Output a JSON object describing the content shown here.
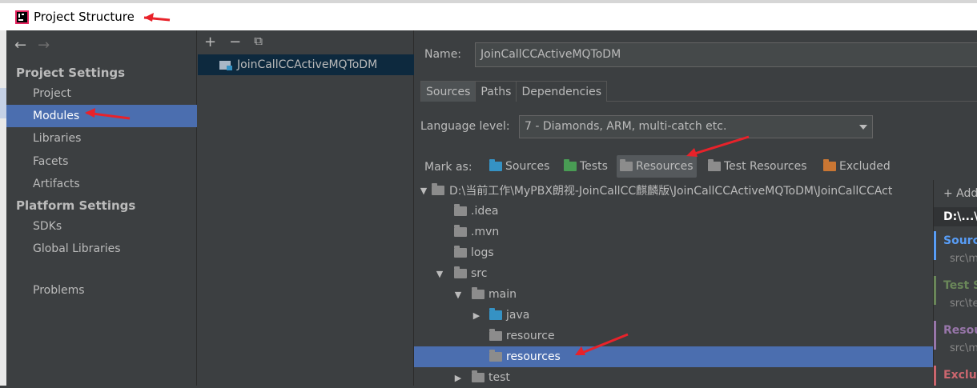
{
  "window": {
    "title": "Project Structure"
  },
  "sidebar": {
    "project_settings_title": "Project Settings",
    "platform_settings_title": "Platform Settings",
    "items": [
      {
        "label": "Project"
      },
      {
        "label": "Modules"
      },
      {
        "label": "Libraries"
      },
      {
        "label": "Facets"
      },
      {
        "label": "Artifacts"
      },
      {
        "label": "SDKs"
      },
      {
        "label": "Global Libraries"
      },
      {
        "label": "Problems"
      }
    ]
  },
  "modules_panel": {
    "toolbar": [
      "+",
      "−",
      "⧉"
    ],
    "module_name": "JoinCallCCActiveMQToDM"
  },
  "module_settings": {
    "name_label": "Name:",
    "name_value": "JoinCallCCActiveMQToDM",
    "tabs": [
      {
        "label": "Sources"
      },
      {
        "label": "Paths"
      },
      {
        "label": "Dependencies"
      }
    ],
    "language_level_label": "Language level:",
    "language_level_value": "7 - Diamonds, ARM, multi-catch etc.",
    "mark_as_label": "Mark as:",
    "mark_as": [
      {
        "label": "Sources",
        "color": "#3592c4"
      },
      {
        "label": "Tests",
        "color": "#499c54"
      },
      {
        "label": "Resources",
        "color": "#8c8c8c"
      },
      {
        "label": "Test Resources",
        "color": "#8c8c8c"
      },
      {
        "label": "Excluded",
        "color": "#c97633"
      }
    ],
    "tree": [
      {
        "label": "D:\\当前工作\\MyPBX朗视-JoinCallCC麒麟版\\JoinCallCCActiveMQToDM\\JoinCallCCAct",
        "toggle": "▼"
      },
      {
        "label": ".idea"
      },
      {
        "label": ".mvn"
      },
      {
        "label": "logs"
      },
      {
        "label": "src",
        "toggle": "▼"
      },
      {
        "label": "main",
        "toggle": "▼"
      },
      {
        "label": "java",
        "toggle": "▶"
      },
      {
        "label": "resource"
      },
      {
        "label": "resources"
      },
      {
        "label": "test",
        "toggle": "▶"
      }
    ],
    "content_roots": {
      "add_label": "+ Add",
      "path": "D:\\...\\",
      "items": [
        {
          "title": "Source",
          "sub": "src\\m",
          "color": "#589df6"
        },
        {
          "title": "Test S",
          "sub": "src\\te",
          "color": "#6a8759"
        },
        {
          "title": "Resou",
          "sub": "src\\m",
          "color": "#9876aa"
        },
        {
          "title": "Exclud",
          "sub": "",
          "color": "#cc666e"
        }
      ]
    }
  }
}
